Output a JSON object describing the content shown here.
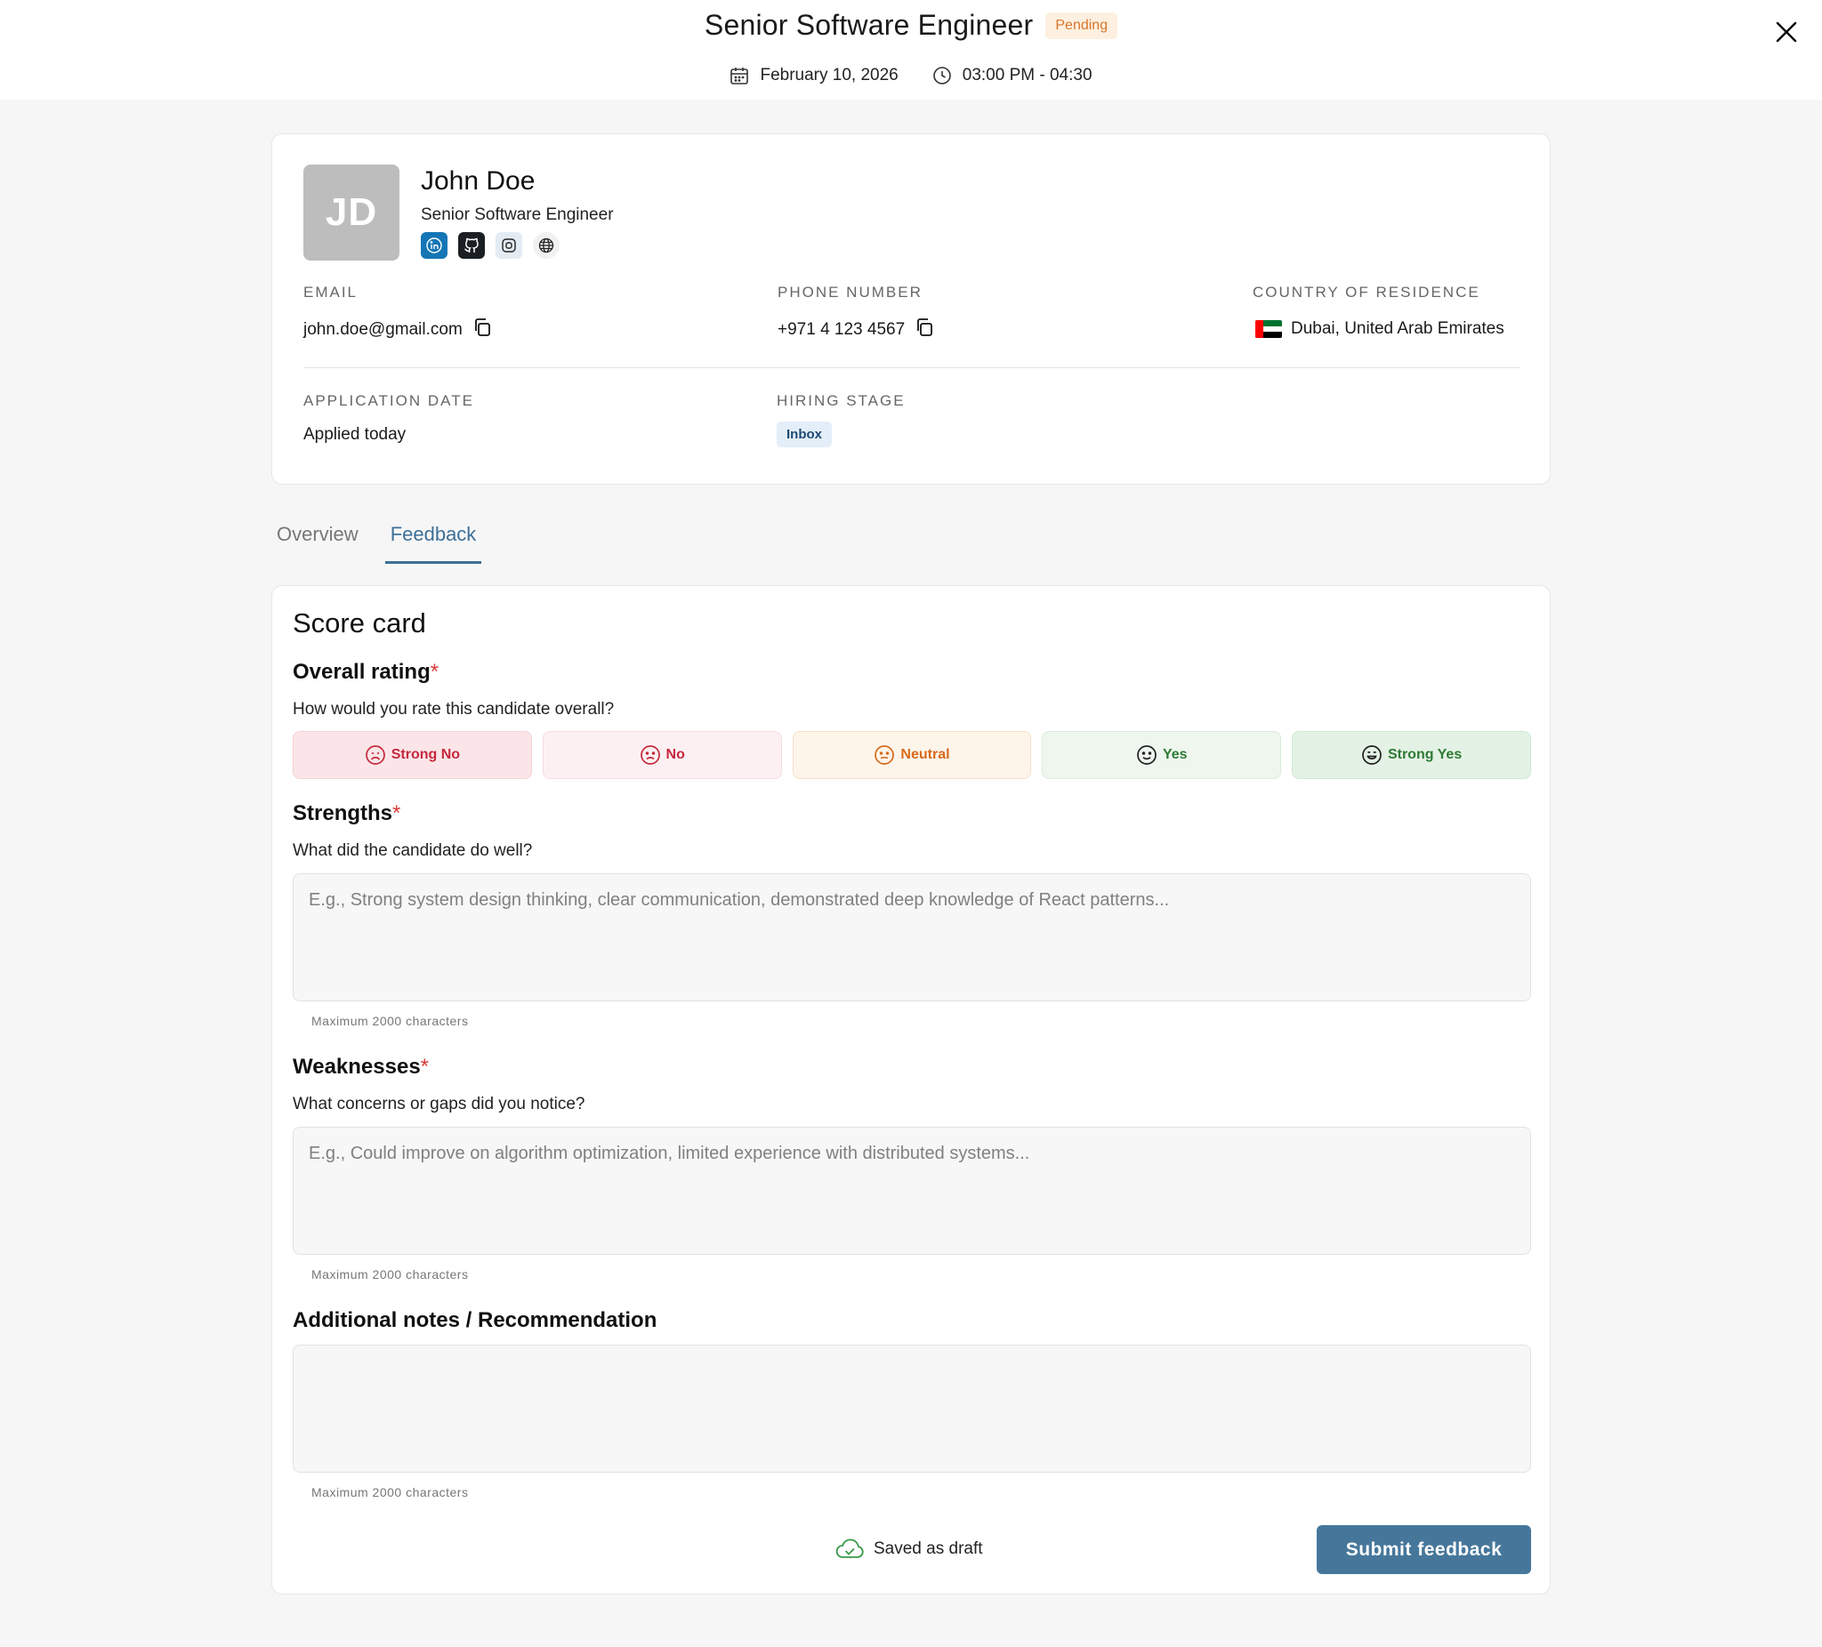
{
  "header": {
    "title": "Senior Software Engineer",
    "status": "Pending",
    "date": "February 10, 2026",
    "time": "03:00 PM - 04:30",
    "icons": {
      "date": "calendar-icon",
      "time": "clock-icon",
      "close": "close-icon"
    }
  },
  "candidate": {
    "initials": "JD",
    "name": "John Doe",
    "role": "Senior Software Engineer",
    "socials": [
      "linkedin-icon",
      "github-icon",
      "portfolio-icon",
      "website-icon"
    ],
    "email_label": "EMAIL",
    "email": "john.doe@gmail.com",
    "phone_label": "PHONE NUMBER",
    "phone": "+971 4 123 4567",
    "country_label": "COUNTRY OF RESIDENCE",
    "country": "Dubai, United Arab Emirates",
    "application_label": "APPLICATION DATE",
    "application": "Applied today",
    "stage_label": "HIRING STAGE",
    "stage": "Inbox"
  },
  "tabs": [
    {
      "label": "Overview",
      "active": false
    },
    {
      "label": "Feedback",
      "active": true
    }
  ],
  "scorecard": {
    "title": "Score card",
    "overall": {
      "title": "Overall rating",
      "required": "*",
      "question": "How would you rate this candidate overall?",
      "options": [
        "Strong No",
        "No",
        "Neutral",
        "Yes",
        "Strong Yes"
      ]
    },
    "strengths": {
      "title": "Strengths",
      "required": "*",
      "question": "What did the candidate do well?",
      "placeholder": "E.g., Strong system design thinking, clear communication, demonstrated deep knowledge of React patterns...",
      "hint": "Maximum 2000 characters"
    },
    "weaknesses": {
      "title": "Weaknesses",
      "required": "*",
      "question": "What concerns or gaps did you notice?",
      "placeholder": "E.g., Could improve on algorithm optimization, limited experience with distributed systems...",
      "hint": "Maximum 2000 characters"
    },
    "notes": {
      "title": "Additional notes / Recommendation",
      "placeholder": "",
      "hint": "Maximum 2000 characters"
    },
    "saved_status": "Saved as draft",
    "submit_label": "Submit feedback"
  },
  "colors": {
    "accent": "#46779b",
    "pending": "#d9752a",
    "required": "#d93a3a"
  }
}
